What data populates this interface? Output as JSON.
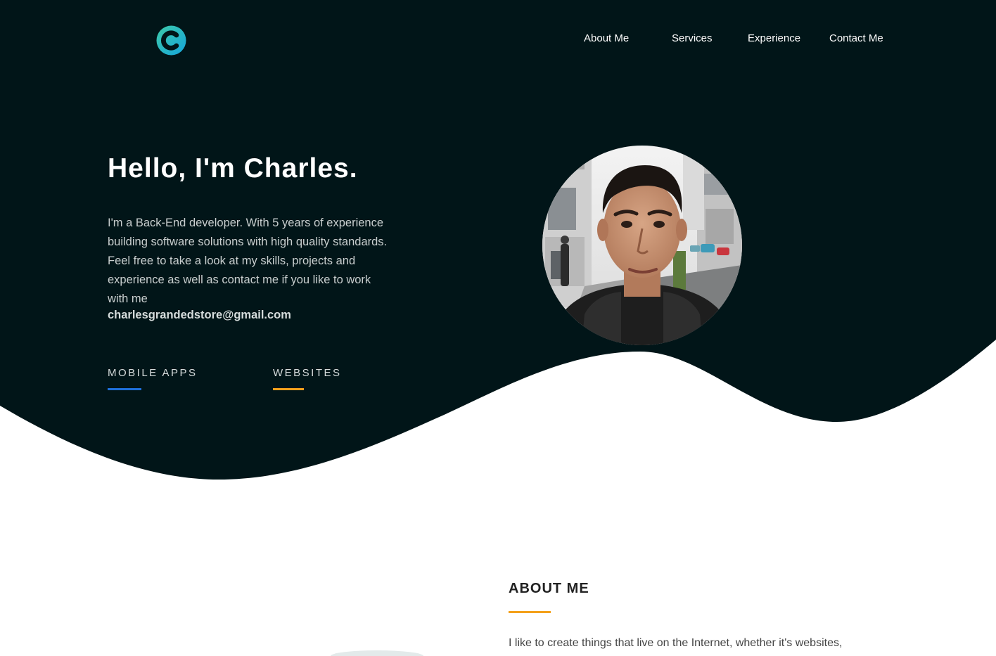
{
  "nav": {
    "items": [
      {
        "label": "About Me"
      },
      {
        "label": "Services"
      },
      {
        "label": "Experience"
      },
      {
        "label": "Contact Me"
      }
    ]
  },
  "hero": {
    "title": "Hello, I'm Charles.",
    "description": "I'm a Back-End developer. With 5 years of experience building software solutions with high quality standards. Feel free to take a look at my skills, projects and experience as well as contact me if you like to work with me",
    "email": "charlesgrandedstore@gmail.com",
    "skills": [
      {
        "label": "MOBILE APPS",
        "color": "#1e6fd9"
      },
      {
        "label": "WEBSITES",
        "color": "#f4a11c"
      }
    ]
  },
  "about": {
    "title": "ABOUT ME",
    "accent_color": "#f4a11c",
    "text": "I like to create things that live on the Internet, whether it's websites,"
  },
  "colors": {
    "hero_background": "#011518",
    "logo_gradient": [
      "#3ec9a8",
      "#14a6dd"
    ]
  },
  "icons": {
    "logo": "c-logo-icon"
  }
}
